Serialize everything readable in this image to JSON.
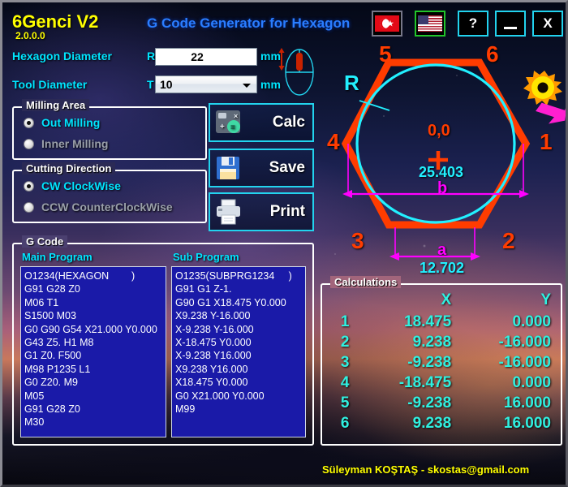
{
  "window": {
    "app_title": "6Genci V2",
    "version": "2.0.0.0",
    "subtitle": "G Code Generator for Hexagon",
    "buttons": {
      "flag_tr": "turkey-flag",
      "flag_us": "usa-flag",
      "help": "?",
      "minimize": "_",
      "close": "X"
    }
  },
  "params": {
    "hexagon_diameter_label": "Hexagon Diameter",
    "r_label": "R =",
    "r_value": "22",
    "r_unit": "mm",
    "tool_diameter_label": "Tool Diameter",
    "t_label": "T =",
    "t_value": "10",
    "t_unit": "mm",
    "t_options": [
      "10"
    ]
  },
  "milling_area": {
    "title": "Milling Area",
    "options": [
      {
        "label": "Out Milling",
        "selected": true
      },
      {
        "label": "Inner Milling",
        "selected": false
      }
    ]
  },
  "cutting_direction": {
    "title": "Cutting Direction",
    "options": [
      {
        "label": "CW ClockWise",
        "selected": true
      },
      {
        "label": "CCW CounterClockWise",
        "selected": false
      }
    ]
  },
  "actions": {
    "calc": "Calc",
    "save": "Save",
    "print": "Print"
  },
  "gcode": {
    "title": "G Code",
    "main_label": "Main Program",
    "sub_label": "Sub Program",
    "main_program": "O1234(HEXAGON        )\nG91 G28 Z0\nM06 T1\nS1500 M03\nG0 G90 G54 X21.000 Y0.000\nG43 Z5. H1 M8\nG1 Z0. F500\nM98 P1235 L1\nG0 Z20. M9\nM05\nG91 G28 Z0\nM30",
    "sub_program": "O1235(SUBPRG1234     )\nG91 G1 Z-1.\nG90 G1 X18.475 Y0.000\nX9.238 Y-16.000\nX-9.238 Y-16.000\nX-18.475 Y0.000\nX-9.238 Y16.000\nX9.238 Y16.000\nX18.475 Y0.000\nG0 X21.000 Y0.000\nM99"
  },
  "calculations": {
    "title": "Calculations",
    "headers": [
      "",
      "X",
      "Y"
    ],
    "rows": [
      {
        "idx": "1",
        "x": "18.475",
        "y": "0.000"
      },
      {
        "idx": "2",
        "x": "9.238",
        "y": "-16.000"
      },
      {
        "idx": "3",
        "x": "-9.238",
        "y": "-16.000"
      },
      {
        "idx": "4",
        "x": "-18.475",
        "y": "0.000"
      },
      {
        "idx": "5",
        "x": "-9.238",
        "y": "16.000"
      },
      {
        "idx": "6",
        "x": "9.238",
        "y": "16.000"
      }
    ]
  },
  "diagram": {
    "vertex_labels": [
      "1",
      "2",
      "3",
      "4",
      "5",
      "6"
    ],
    "radius_label": "R",
    "origin_label": "0,0",
    "origin_marker": "+",
    "dim_b_value": "25.403",
    "dim_b_label": "b",
    "dim_a_value": "12.702",
    "dim_a_label": "a",
    "cutter_icon": "rotating-cutter-icon",
    "direction_icon": "cw-direction-arrow-icon"
  },
  "footer": {
    "credit": "Süleyman KOŞTAŞ - skostas@gmail.com"
  },
  "colors": {
    "accent_cyan": "#00e5ff",
    "hex_orange": "#ff3c00",
    "circle_cyan": "#22f0ff",
    "dim_magenta": "#ff00ff",
    "title_yellow": "#ffff00",
    "subtitle_blue": "#2a7dff",
    "code_bg": "#1a1aa8",
    "calc_text": "#2ff0e0"
  }
}
